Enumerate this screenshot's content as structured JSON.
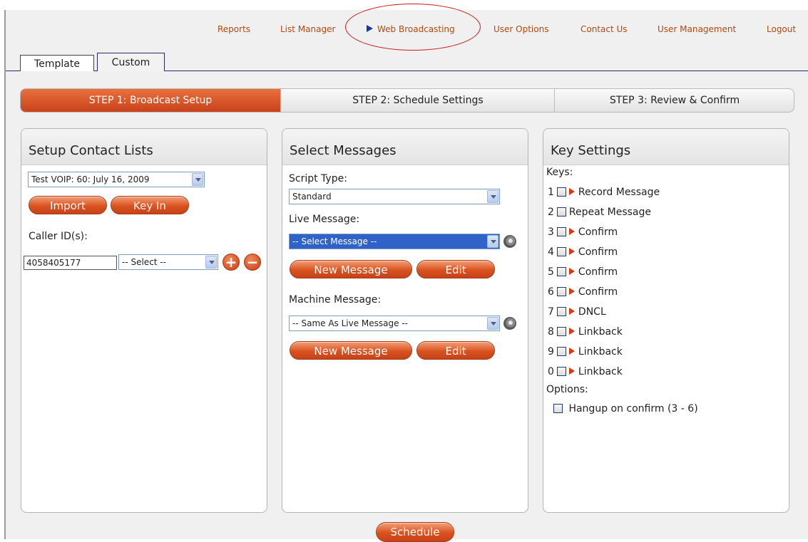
{
  "nav": {
    "items": [
      "Reports",
      "List Manager",
      "Web Broadcasting",
      "User Options",
      "Contact Us",
      "User Management",
      "Logout"
    ],
    "active": "Web Broadcasting"
  },
  "tabs": [
    "Template",
    "Custom"
  ],
  "steps": [
    "STEP 1: Broadcast Setup",
    "STEP 2: Schedule Settings",
    "STEP 3: Review & Confirm"
  ],
  "contact_lists": {
    "title": "Setup Contact Lists",
    "list_value": "Test VOIP: 60: July 16, 2009",
    "import_label": "Import",
    "keyin_label": "Key In",
    "caller_id_label": "Caller ID(s):",
    "caller_id_value": "4058405177",
    "caller_select": "-- Select --"
  },
  "messages": {
    "title": "Select Messages",
    "script_type_label": "Script Type:",
    "script_type_value": "Standard",
    "live_label": "Live Message:",
    "live_value": "-- Select Message --",
    "new_message_label": "New Message",
    "edit_label": "Edit",
    "machine_label": "Machine Message:",
    "machine_value": "-- Same As Live Message --"
  },
  "keys": {
    "title": "Key Settings",
    "keys_label": "Keys:",
    "rows": [
      {
        "key": "1",
        "label": "Record Message",
        "arrow": true
      },
      {
        "key": "2",
        "label": "Repeat Message",
        "arrow": false
      },
      {
        "key": "3",
        "label": "Confirm",
        "arrow": true
      },
      {
        "key": "4",
        "label": "Confirm",
        "arrow": true
      },
      {
        "key": "5",
        "label": "Confirm",
        "arrow": true
      },
      {
        "key": "6",
        "label": "Confirm",
        "arrow": true
      },
      {
        "key": "7",
        "label": "DNCL",
        "arrow": true
      },
      {
        "key": "8",
        "label": "Linkback",
        "arrow": true
      },
      {
        "key": "9",
        "label": "Linkback",
        "arrow": true
      },
      {
        "key": "0",
        "label": "Linkback",
        "arrow": true
      }
    ],
    "options_label": "Options:",
    "hangup_label": "Hangup on confirm (3 - 6)"
  },
  "schedule_label": "Schedule",
  "colors": {
    "accent": "#d9521f",
    "nav_text": "#b04a10",
    "annotation": "#d01818"
  }
}
